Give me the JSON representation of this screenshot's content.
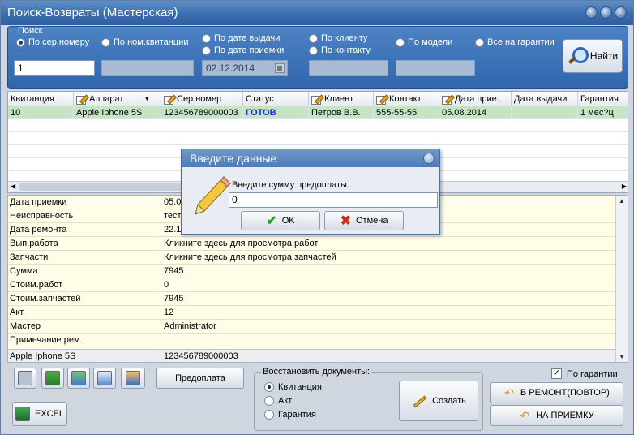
{
  "window": {
    "title": "Поиск-Возвраты (Мастерская)"
  },
  "search": {
    "legend": "Поиск",
    "radios": [
      {
        "label": "По сер.номеру",
        "checked": true
      },
      {
        "label": "По ном.квитанции",
        "checked": false
      },
      {
        "label": "По дате выдачи",
        "checked": false
      },
      {
        "label": "По дате приемки",
        "checked": false
      },
      {
        "label": "По клиенту",
        "checked": false
      },
      {
        "label": "По контакту",
        "checked": false
      },
      {
        "label": "По модели",
        "checked": false
      },
      {
        "label": "Все на гарантии",
        "checked": false
      }
    ],
    "serial_value": "1",
    "date_value": "02.12.2014",
    "find_label": "Найти"
  },
  "grid": {
    "columns": [
      "Квитанция",
      "Аппарат",
      "Сер.номер",
      "Статус",
      "Клиент",
      "Контакт",
      "Дата прие...",
      "Дата выдачи",
      "Гарантия"
    ],
    "rows": [
      [
        "10",
        "Apple Iphone 5S",
        "123456789000003",
        "ГОТОВ",
        "Петров В.В.",
        "555-55-55",
        "05.08.2014",
        "",
        "1 мес?ц"
      ]
    ]
  },
  "details": {
    "rows": [
      {
        "label": "Дата приемки",
        "value": "05.08.2014"
      },
      {
        "label": "Неисправность",
        "value": "тест"
      },
      {
        "label": "Дата ремонта",
        "value": "22.10.2014"
      },
      {
        "label": "Вып.работа",
        "value": "Кликните здесь для просмотра работ"
      },
      {
        "label": "Запчасти",
        "value": "Кликните здесь для просмотра запчастей"
      },
      {
        "label": "Сумма",
        "value": "7945"
      },
      {
        "label": "Стоим.работ",
        "value": "0"
      },
      {
        "label": "Стоим.запчастей",
        "value": "7945"
      },
      {
        "label": "Акт",
        "value": "12"
      },
      {
        "label": "Мастер",
        "value": "Administrator"
      },
      {
        "label": "Примечание рем.",
        "value": ""
      }
    ],
    "footer": {
      "device": "Apple Iphone 5S",
      "serial": "123456789000003"
    }
  },
  "toolbar": {
    "prepay_label": "Предоплата",
    "excel_label": "EXCEL"
  },
  "restore": {
    "legend": "Восстановить документы:",
    "options": [
      {
        "label": "Квитанция",
        "checked": true
      },
      {
        "label": "Акт",
        "checked": false
      },
      {
        "label": "Гарантия",
        "checked": false
      }
    ],
    "create_label": "Создать"
  },
  "right": {
    "warranty_label": "По гарантии",
    "warranty_checked": true,
    "repair_again_label": "В РЕМОНТ(ПОВТОР)",
    "to_intake_label": "НА ПРИЕМКУ"
  },
  "dialog": {
    "title": "Введите данные",
    "prompt": "Введите сумму предоплаты.",
    "value": "0",
    "ok_label": "OK",
    "cancel_label": "Отмена"
  }
}
